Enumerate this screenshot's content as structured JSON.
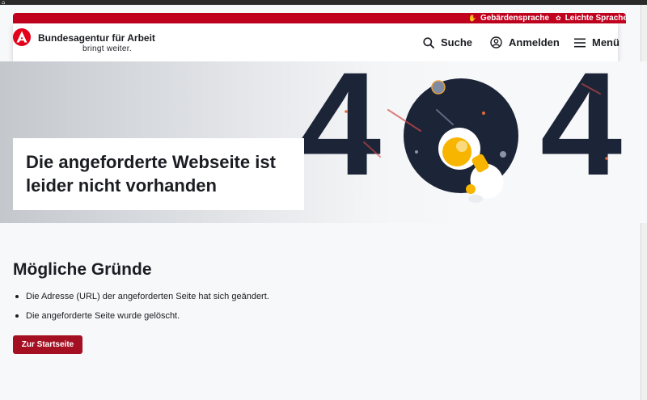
{
  "topbar": {
    "sign_language_label": "Gebärdensprache",
    "sign_language_icon": "hand-icon",
    "easy_language_label": "Leichte Sprache",
    "easy_language_icon": "book-icon"
  },
  "header": {
    "brand_name": "Bundesagentur für Arbeit",
    "brand_tagline": "bringt weiter.",
    "nav": {
      "search_label": "Suche",
      "login_label": "Anmelden",
      "menu_label": "Menü"
    }
  },
  "hero": {
    "error_code": "404",
    "title": "Die angeforderte Webseite ist leider nicht vorhanden"
  },
  "reasons": {
    "title": "Mögliche Gründe",
    "items": [
      "Die Adresse (URL) der angeforderten Seite hat sich geändert.",
      "Die angeforderte Seite wurde gelöscht."
    ]
  },
  "actions": {
    "home_label": "Zur Startseite"
  },
  "colors": {
    "brand_red": "#c1001e",
    "button_red": "#a50f22",
    "text_dark": "#1b1d22",
    "navy": "#1c2437",
    "astronaut_yellow": "#f7b500"
  }
}
